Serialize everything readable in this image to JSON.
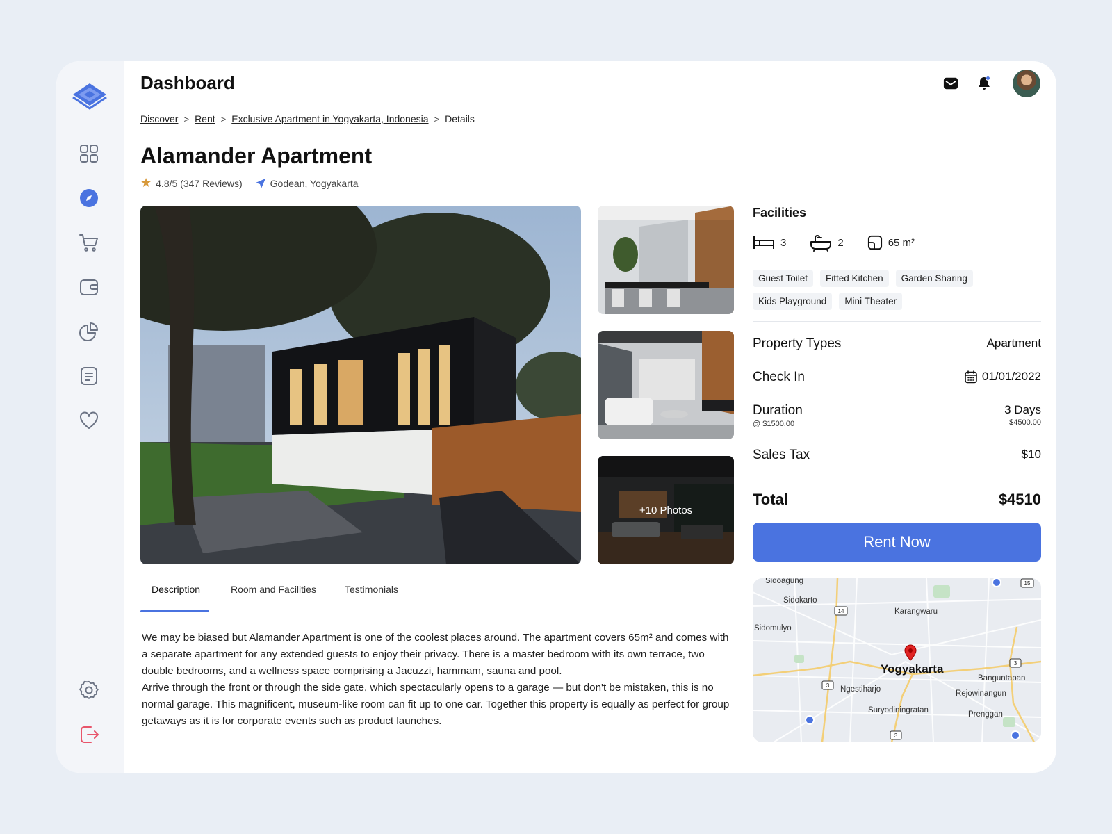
{
  "topbar": {
    "title": "Dashboard"
  },
  "breadcrumb": {
    "items": [
      "Discover",
      "Rent",
      "Exclusive Apartment in Yogyakarta, Indonesia"
    ],
    "current": "Details",
    "separator": ">"
  },
  "property": {
    "title": "Alamander Apartment",
    "rating": "4.8/5 (347 Reviews)",
    "location": "Godean, Yogyakarta",
    "more_photos": "+10 Photos"
  },
  "tabs": [
    "Description",
    "Room and Facilities",
    "Testimonials"
  ],
  "description": {
    "p1": "We may be biased but Alamander Apartment is one of the coolest places around. The apartment covers 65m² and comes with a separate apartment for any extended guests to enjoy their privacy. There is a master bedroom with its own terrace, two double bedrooms, and a wellness space comprising a Jacuzzi, hammam, sauna and pool.",
    "p2": "Arrive through the front or through the side gate, which spectacularly opens to a garage — but don't be mistaken, this is no normal garage. This magnificent, museum-like room can fit up to one car. Together this property is equally as perfect for group getaways as it is for corporate events such as product launches."
  },
  "facilities": {
    "title": "Facilities",
    "beds": "3",
    "baths": "2",
    "area": "65 m²",
    "tags": [
      "Guest Toilet",
      "Fitted Kitchen",
      "Garden Sharing",
      "Kids Playground",
      "Mini Theater"
    ]
  },
  "booking": {
    "property_types_label": "Property Types",
    "property_types_value": "Apartment",
    "check_in_label": "Check In",
    "check_in_value": "01/01/2022",
    "duration_label": "Duration",
    "duration_rate": "@ $1500.00",
    "duration_value": "3 Days",
    "duration_subtotal": "$4500.00",
    "sales_tax_label": "Sales Tax",
    "sales_tax_value": "$10",
    "total_label": "Total",
    "total_value": "$4510",
    "rent_button": "Rent Now"
  },
  "map": {
    "city": "Yogyakarta",
    "labels": [
      "Sidoagung",
      "Sidokarto",
      "Karangwaru",
      "Sidomulyo",
      "Ngestiharjo",
      "Banguntapan",
      "Rejowinangun",
      "Suryodiningratan",
      "Prenggan"
    ],
    "road_numbers": [
      "14",
      "15",
      "3",
      "3",
      "3"
    ]
  },
  "colors": {
    "accent": "#4a73e0",
    "logout": "#e8556b",
    "star": "#d89a3b",
    "map_pin": "#e02424"
  }
}
